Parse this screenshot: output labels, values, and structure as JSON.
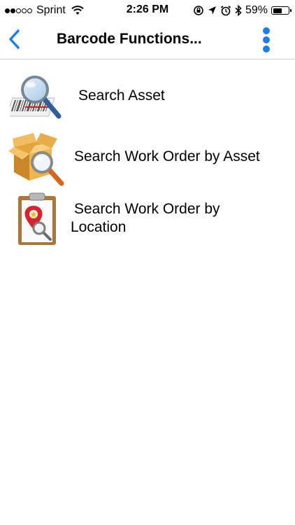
{
  "status_bar": {
    "carrier": "Sprint",
    "time": "2:26 PM",
    "battery_percent": "59%",
    "battery_level": 0.59,
    "signal_bars_filled": 2,
    "signal_bars_total": 5
  },
  "nav": {
    "title": "Barcode Functions...",
    "back_icon": "chevron-left-icon",
    "more_icon": "vertical-ellipsis-icon",
    "accent_color": "#1a7ef2"
  },
  "menu": {
    "items": [
      {
        "label": "Search Asset",
        "icon": "barcode-search-icon"
      },
      {
        "label": "Search Work Order by Asset",
        "icon": "box-search-icon"
      },
      {
        "label_line1": "Search Work Order by",
        "label_line2": "Location",
        "icon": "clipboard-location-icon"
      }
    ]
  }
}
